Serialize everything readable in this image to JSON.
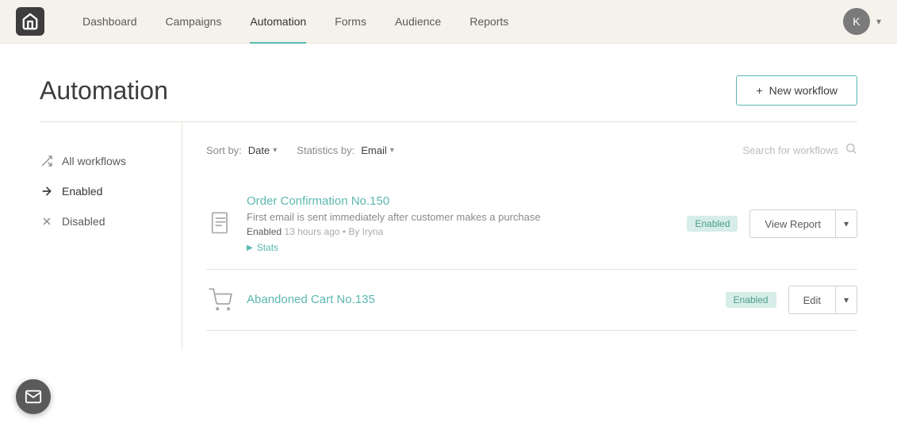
{
  "app": {
    "logo_alt": "App Logo"
  },
  "nav": {
    "links": [
      {
        "label": "Dashboard",
        "active": false
      },
      {
        "label": "Campaigns",
        "active": false
      },
      {
        "label": "Automation",
        "active": true
      },
      {
        "label": "Forms",
        "active": false
      },
      {
        "label": "Audience",
        "active": false
      },
      {
        "label": "Reports",
        "active": false
      }
    ],
    "user_initial": "K",
    "chevron": "▾"
  },
  "page": {
    "title": "Automation",
    "new_workflow_plus": "+",
    "new_workflow_label": "New workflow"
  },
  "sidebar": {
    "items": [
      {
        "id": "all",
        "label": "All workflows",
        "icon": "shuffle"
      },
      {
        "id": "enabled",
        "label": "Enabled",
        "icon": "arrow-right",
        "active": true
      },
      {
        "id": "disabled",
        "label": "Disabled",
        "icon": "x"
      }
    ]
  },
  "filter_bar": {
    "sort_label": "Sort by:",
    "sort_value": "Date",
    "stats_label": "Statistics by:",
    "stats_value": "Email",
    "search_placeholder": "Search for workflows"
  },
  "workflows": [
    {
      "id": 1,
      "name": "Order Confirmation No.150",
      "description": "First email is sent immediately after customer makes a purchase",
      "status": "Enabled",
      "meta_enabled": "Enabled",
      "meta_time": "13 hours ago",
      "meta_by": "By Iryna",
      "stats_label": "Stats",
      "primary_action": "View Report",
      "icon_type": "document"
    },
    {
      "id": 2,
      "name": "Abandoned Cart No.135",
      "description": "",
      "status": "Enabled",
      "meta_enabled": "",
      "meta_time": "",
      "meta_by": "",
      "stats_label": "",
      "primary_action": "Edit",
      "icon_type": "cart"
    }
  ],
  "floating": {
    "icon_label": "mail-icon"
  }
}
